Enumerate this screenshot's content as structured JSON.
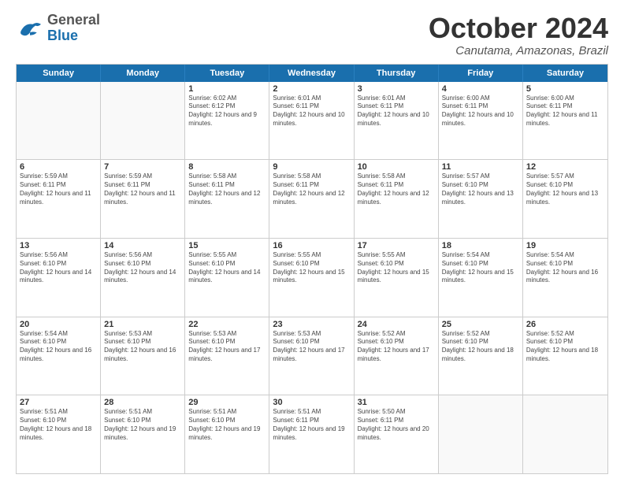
{
  "header": {
    "logo": {
      "general": "General",
      "blue": "Blue"
    },
    "title": "October 2024",
    "location": "Canutama, Amazonas, Brazil"
  },
  "weekdays": [
    "Sunday",
    "Monday",
    "Tuesday",
    "Wednesday",
    "Thursday",
    "Friday",
    "Saturday"
  ],
  "weeks": [
    [
      {
        "day": "",
        "text": ""
      },
      {
        "day": "",
        "text": ""
      },
      {
        "day": "1",
        "text": "Sunrise: 6:02 AM\nSunset: 6:12 PM\nDaylight: 12 hours and 9 minutes."
      },
      {
        "day": "2",
        "text": "Sunrise: 6:01 AM\nSunset: 6:11 PM\nDaylight: 12 hours and 10 minutes."
      },
      {
        "day": "3",
        "text": "Sunrise: 6:01 AM\nSunset: 6:11 PM\nDaylight: 12 hours and 10 minutes."
      },
      {
        "day": "4",
        "text": "Sunrise: 6:00 AM\nSunset: 6:11 PM\nDaylight: 12 hours and 10 minutes."
      },
      {
        "day": "5",
        "text": "Sunrise: 6:00 AM\nSunset: 6:11 PM\nDaylight: 12 hours and 11 minutes."
      }
    ],
    [
      {
        "day": "6",
        "text": "Sunrise: 5:59 AM\nSunset: 6:11 PM\nDaylight: 12 hours and 11 minutes."
      },
      {
        "day": "7",
        "text": "Sunrise: 5:59 AM\nSunset: 6:11 PM\nDaylight: 12 hours and 11 minutes."
      },
      {
        "day": "8",
        "text": "Sunrise: 5:58 AM\nSunset: 6:11 PM\nDaylight: 12 hours and 12 minutes."
      },
      {
        "day": "9",
        "text": "Sunrise: 5:58 AM\nSunset: 6:11 PM\nDaylight: 12 hours and 12 minutes."
      },
      {
        "day": "10",
        "text": "Sunrise: 5:58 AM\nSunset: 6:11 PM\nDaylight: 12 hours and 12 minutes."
      },
      {
        "day": "11",
        "text": "Sunrise: 5:57 AM\nSunset: 6:10 PM\nDaylight: 12 hours and 13 minutes."
      },
      {
        "day": "12",
        "text": "Sunrise: 5:57 AM\nSunset: 6:10 PM\nDaylight: 12 hours and 13 minutes."
      }
    ],
    [
      {
        "day": "13",
        "text": "Sunrise: 5:56 AM\nSunset: 6:10 PM\nDaylight: 12 hours and 14 minutes."
      },
      {
        "day": "14",
        "text": "Sunrise: 5:56 AM\nSunset: 6:10 PM\nDaylight: 12 hours and 14 minutes."
      },
      {
        "day": "15",
        "text": "Sunrise: 5:55 AM\nSunset: 6:10 PM\nDaylight: 12 hours and 14 minutes."
      },
      {
        "day": "16",
        "text": "Sunrise: 5:55 AM\nSunset: 6:10 PM\nDaylight: 12 hours and 15 minutes."
      },
      {
        "day": "17",
        "text": "Sunrise: 5:55 AM\nSunset: 6:10 PM\nDaylight: 12 hours and 15 minutes."
      },
      {
        "day": "18",
        "text": "Sunrise: 5:54 AM\nSunset: 6:10 PM\nDaylight: 12 hours and 15 minutes."
      },
      {
        "day": "19",
        "text": "Sunrise: 5:54 AM\nSunset: 6:10 PM\nDaylight: 12 hours and 16 minutes."
      }
    ],
    [
      {
        "day": "20",
        "text": "Sunrise: 5:54 AM\nSunset: 6:10 PM\nDaylight: 12 hours and 16 minutes."
      },
      {
        "day": "21",
        "text": "Sunrise: 5:53 AM\nSunset: 6:10 PM\nDaylight: 12 hours and 16 minutes."
      },
      {
        "day": "22",
        "text": "Sunrise: 5:53 AM\nSunset: 6:10 PM\nDaylight: 12 hours and 17 minutes."
      },
      {
        "day": "23",
        "text": "Sunrise: 5:53 AM\nSunset: 6:10 PM\nDaylight: 12 hours and 17 minutes."
      },
      {
        "day": "24",
        "text": "Sunrise: 5:52 AM\nSunset: 6:10 PM\nDaylight: 12 hours and 17 minutes."
      },
      {
        "day": "25",
        "text": "Sunrise: 5:52 AM\nSunset: 6:10 PM\nDaylight: 12 hours and 18 minutes."
      },
      {
        "day": "26",
        "text": "Sunrise: 5:52 AM\nSunset: 6:10 PM\nDaylight: 12 hours and 18 minutes."
      }
    ],
    [
      {
        "day": "27",
        "text": "Sunrise: 5:51 AM\nSunset: 6:10 PM\nDaylight: 12 hours and 18 minutes."
      },
      {
        "day": "28",
        "text": "Sunrise: 5:51 AM\nSunset: 6:10 PM\nDaylight: 12 hours and 19 minutes."
      },
      {
        "day": "29",
        "text": "Sunrise: 5:51 AM\nSunset: 6:10 PM\nDaylight: 12 hours and 19 minutes."
      },
      {
        "day": "30",
        "text": "Sunrise: 5:51 AM\nSunset: 6:11 PM\nDaylight: 12 hours and 19 minutes."
      },
      {
        "day": "31",
        "text": "Sunrise: 5:50 AM\nSunset: 6:11 PM\nDaylight: 12 hours and 20 minutes."
      },
      {
        "day": "",
        "text": ""
      },
      {
        "day": "",
        "text": ""
      }
    ]
  ]
}
